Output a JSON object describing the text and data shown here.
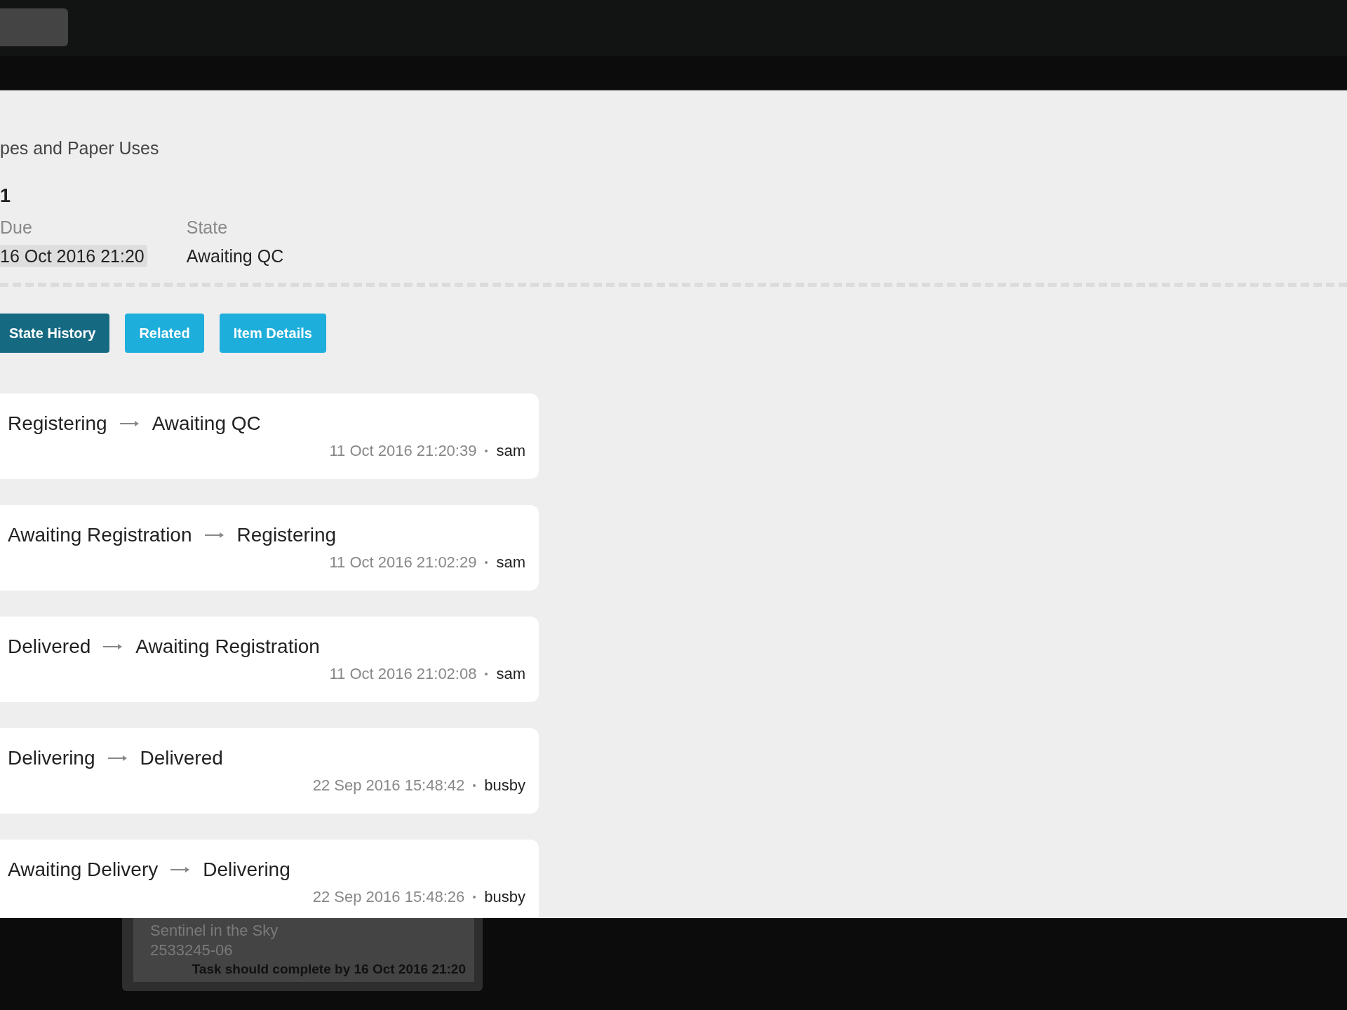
{
  "header": {
    "title": "pes and Paper Uses",
    "number": "1"
  },
  "fields": [
    {
      "label": "Due",
      "value": "16 Oct 2016 21:20",
      "highlighted": true
    },
    {
      "label": "State",
      "value": "Awaiting QC",
      "highlighted": false
    }
  ],
  "tabs": [
    {
      "label": "State History",
      "selected": true
    },
    {
      "label": "Related",
      "selected": false
    },
    {
      "label": "Item Details",
      "selected": false
    }
  ],
  "history": [
    {
      "from": "Registering",
      "to": "Awaiting QC",
      "time": "11 Oct 2016 21:20:39",
      "user": "sam"
    },
    {
      "from": "Awaiting Registration",
      "to": "Registering",
      "time": "11 Oct 2016 21:02:29",
      "user": "sam"
    },
    {
      "from": "Delivered",
      "to": "Awaiting Registration",
      "time": "11 Oct 2016 21:02:08",
      "user": "sam"
    },
    {
      "from": "Delivering",
      "to": "Delivered",
      "time": "22 Sep 2016 15:48:42",
      "user": "busby"
    },
    {
      "from": "Awaiting Delivery",
      "to": "Delivering",
      "time": "22 Sep 2016 15:48:26",
      "user": "busby"
    }
  ],
  "tooltip": {
    "title": "Sentinel in the Sky",
    "code": "2533245-06",
    "due_note": "Task should complete by 16 Oct 2016 21:20"
  }
}
